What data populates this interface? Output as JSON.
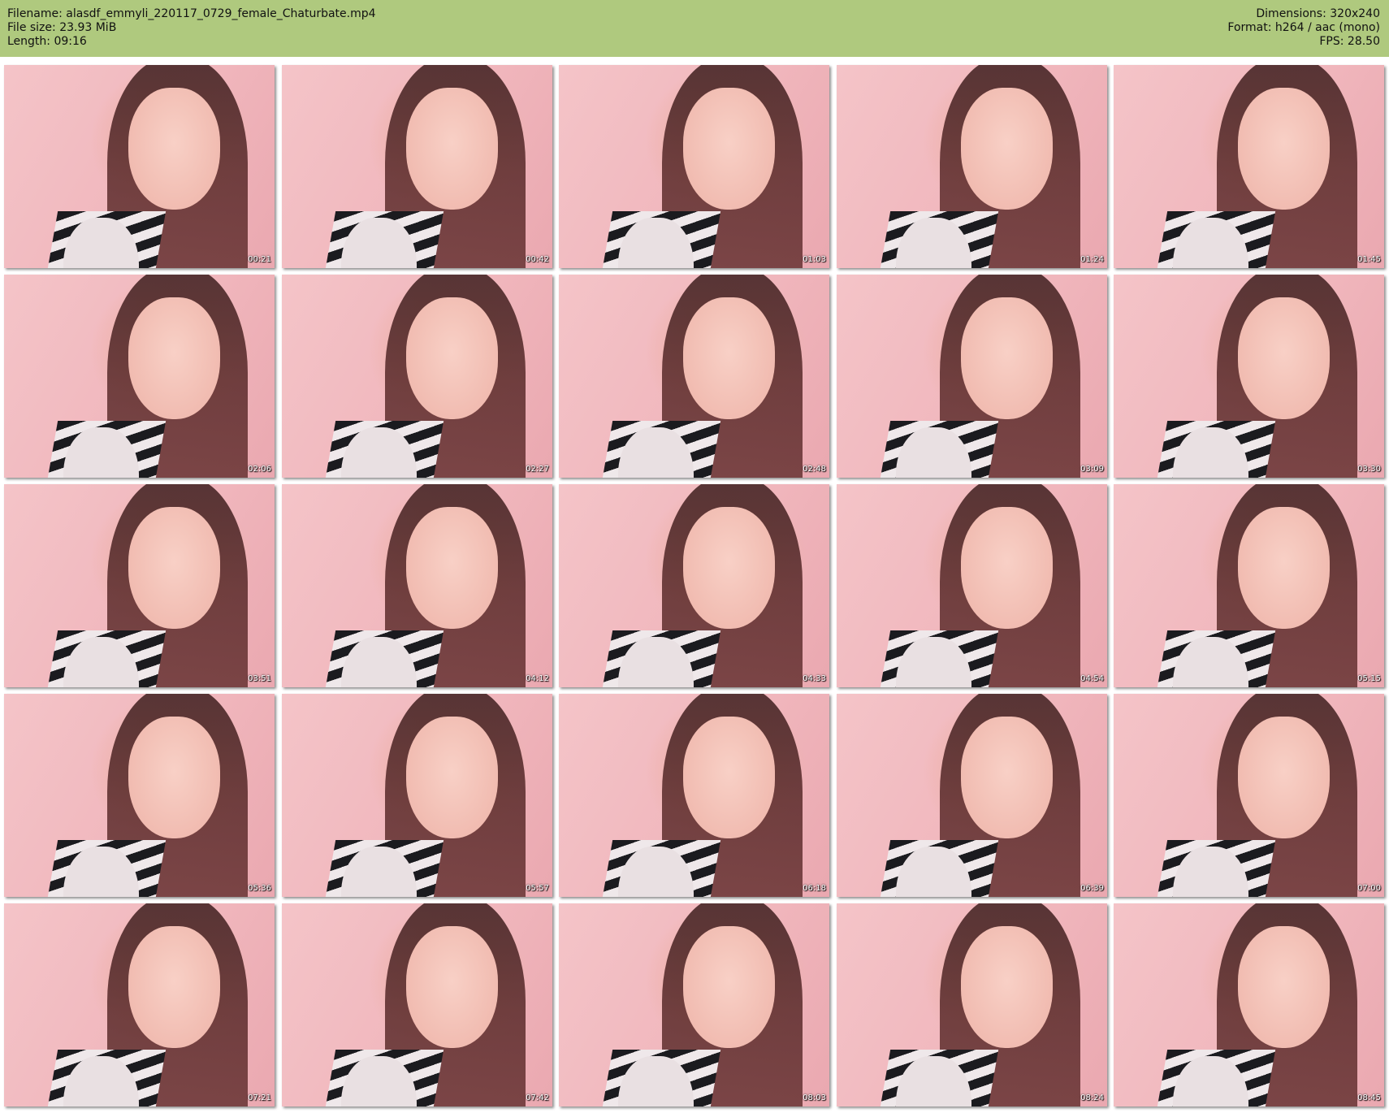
{
  "header": {
    "filename": "Filename: alasdf_emmyli_220117_0729_female_Chaturbate.mp4",
    "file_size": "File size: 23.93 MiB",
    "length": "Length: 09:16",
    "dimensions": "Dimensions: 320x240",
    "format": "Format: h264 / aac (mono)",
    "fps": "FPS: 28.50"
  },
  "colors": {
    "header_bg": "#afc97e",
    "page_bg": "#ffffff"
  },
  "thumbnails": [
    {
      "timestamp": "00:21"
    },
    {
      "timestamp": "00:42"
    },
    {
      "timestamp": "01:03"
    },
    {
      "timestamp": "01:24"
    },
    {
      "timestamp": "01:45"
    },
    {
      "timestamp": "02:06"
    },
    {
      "timestamp": "02:27"
    },
    {
      "timestamp": "02:48"
    },
    {
      "timestamp": "03:09"
    },
    {
      "timestamp": "03:30"
    },
    {
      "timestamp": "03:51"
    },
    {
      "timestamp": "04:12"
    },
    {
      "timestamp": "04:33"
    },
    {
      "timestamp": "04:54"
    },
    {
      "timestamp": "05:15"
    },
    {
      "timestamp": "05:36"
    },
    {
      "timestamp": "05:57"
    },
    {
      "timestamp": "06:18"
    },
    {
      "timestamp": "06:39"
    },
    {
      "timestamp": "07:00"
    },
    {
      "timestamp": "07:21"
    },
    {
      "timestamp": "07:42"
    },
    {
      "timestamp": "08:03"
    },
    {
      "timestamp": "08:24"
    },
    {
      "timestamp": "08:45"
    }
  ]
}
